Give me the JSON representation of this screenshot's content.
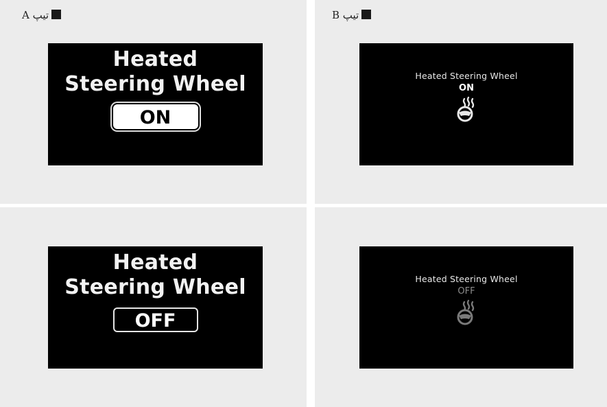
{
  "type_a": {
    "label": "تیپ A",
    "on": {
      "title_line1": "Heated",
      "title_line2": "Steering Wheel",
      "status": "ON"
    },
    "off": {
      "title_line1": "Heated",
      "title_line2": "Steering Wheel",
      "status": "OFF"
    }
  },
  "type_b": {
    "label": "تیپ B",
    "on": {
      "title": "Heated Steering Wheel",
      "status": "ON",
      "icon": "heated-steering-wheel-icon"
    },
    "off": {
      "title": "Heated Steering Wheel",
      "status": "OFF",
      "icon": "heated-steering-wheel-icon"
    }
  },
  "colors": {
    "background": "#ececec",
    "screen": "#000000",
    "text": "#ffffff",
    "dim": "#8c8c8c"
  }
}
